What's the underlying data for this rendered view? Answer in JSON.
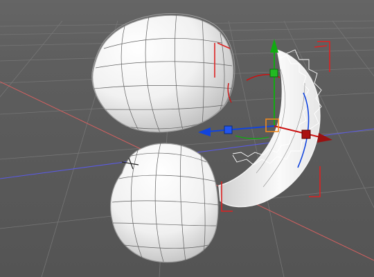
{
  "viewport": {
    "view": "perspective-3d",
    "background_color": "#5e5e5e",
    "grid_color": "#7a7a7a",
    "x_axis_color": "#d46060",
    "z_axis_color": "#5a5ae6"
  },
  "objects": [
    {
      "name": "head-mesh",
      "selected": false,
      "shading": "smooth-wireframe",
      "color": "#f2f2f2"
    },
    {
      "name": "body-mesh",
      "selected": false,
      "shading": "smooth-wireframe",
      "color": "#f2f2f2"
    },
    {
      "name": "tail-mesh",
      "selected": true,
      "shading": "smooth-wireframe",
      "color": "#f2f2f2"
    }
  ],
  "gizmo": {
    "type": "move-rotate",
    "x_color": "#cc1111",
    "y_color": "#11aa11",
    "z_color": "#1144dd",
    "pivot_color": "#f08a20",
    "selection_bracket_color": "#dd2222"
  }
}
